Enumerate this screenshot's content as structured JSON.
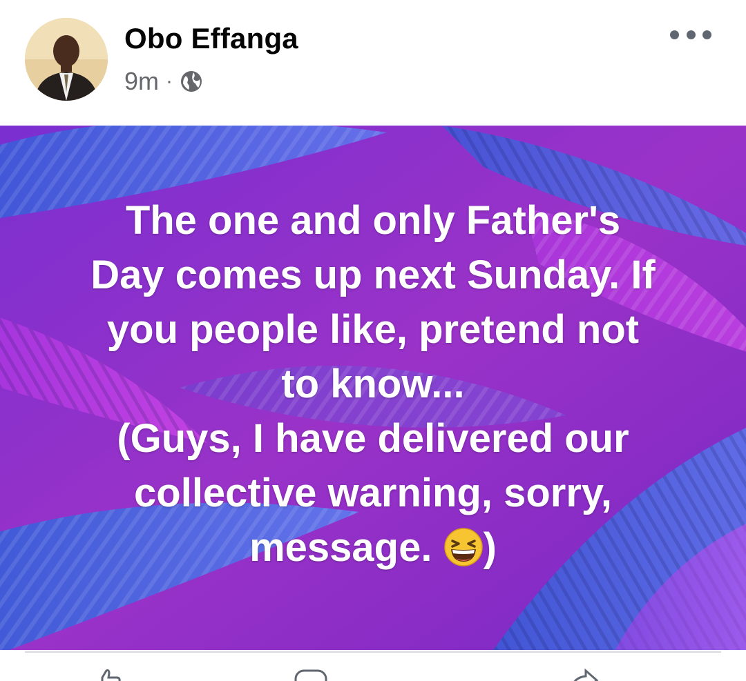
{
  "post": {
    "author": {
      "name": "Obo Effanga",
      "avatar_icon": "avatar-photo"
    },
    "meta": {
      "time": "9m",
      "separator": "·",
      "audience_icon": "globe-icon"
    },
    "more_icon": "more-options-icon",
    "text_lines": [
      "The one and only Father's",
      "Day comes up next Sunday. If",
      "you people like, pretend not",
      "to know...",
      "(Guys, I have delivered our",
      "collective warning, sorry,"
    ],
    "last_line_text": "message. ",
    "last_line_emoji": "grinning-squinting-face-emoji",
    "last_line_close": ")",
    "background": {
      "theme": "purple-palm-leaves",
      "base_color": "#8a2bc8",
      "leaf_blue": "#3d6ee0",
      "leaf_pink": "#d23cf0"
    },
    "actions": [
      "like-icon",
      "comment-icon",
      "share-icon"
    ]
  }
}
